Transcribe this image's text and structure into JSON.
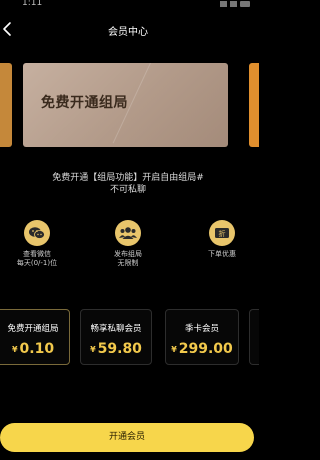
{
  "status_bar": {
    "time": "1:11"
  },
  "header": {
    "title": "会员中心",
    "back_icon": "arrow-left-icon"
  },
  "banner": {
    "title": "免费开通组局"
  },
  "description": {
    "line1": "免费开通【组局功能】开启自由组局#",
    "line2": "不可私聊"
  },
  "benefits": [
    {
      "icon": "wechat-icon",
      "line1": "查看微信",
      "line2": "每天(0/-1)位"
    },
    {
      "icon": "group-icon",
      "line1": "发布组局",
      "line2": "无限制"
    },
    {
      "icon": "discount-icon",
      "line1": "下单优惠",
      "line2": ""
    }
  ],
  "plans": [
    {
      "title": "免费开通组局",
      "currency": "¥",
      "price": "0.10"
    },
    {
      "title": "畅享私聊会员",
      "currency": "¥",
      "price": "59.80"
    },
    {
      "title": "季卡会员",
      "currency": "¥",
      "price": "299.00"
    }
  ],
  "cta": {
    "label": "开通会员"
  },
  "colors": {
    "accent": "#f7d64b",
    "price": "#f2c94c",
    "background": "#000000"
  }
}
